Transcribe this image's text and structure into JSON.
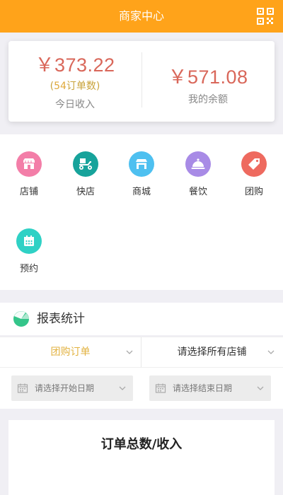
{
  "header": {
    "title": "商家中心",
    "qr_icon": "qr-code-icon",
    "bg_color": "#ffa31a"
  },
  "income": {
    "today": {
      "amount": "￥373.22",
      "order_prefix": "(",
      "order_count": "54",
      "order_suffix": "订单数)",
      "label": "今日收入"
    },
    "balance": {
      "amount": "￥571.08",
      "label": "我的余额"
    },
    "amount_color": "#d9675a"
  },
  "categories": [
    {
      "label": "店铺",
      "icon": "storefront-icon",
      "color": "#f37ea8"
    },
    {
      "label": "快店",
      "icon": "delivery-scooter-icon",
      "color": "#17a39b"
    },
    {
      "label": "商城",
      "icon": "shop-icon",
      "color": "#4ec0f0"
    },
    {
      "label": "餐饮",
      "icon": "food-cloche-icon",
      "color": "#a88be6"
    },
    {
      "label": "团购",
      "icon": "tag-icon",
      "color": "#ee6a5f"
    },
    {
      "label": "预约",
      "icon": "calendar-icon",
      "color": "#2fd1c5"
    }
  ],
  "report": {
    "title": "报表统计",
    "icon": "report-chart-icon",
    "filters": {
      "type_selected": "团购订单",
      "store_selected": "请选择所有店铺"
    },
    "dates": {
      "start_placeholder": "请选择开始日期",
      "end_placeholder": "请选择结束日期"
    },
    "summary_title": "订单总数/收入"
  }
}
